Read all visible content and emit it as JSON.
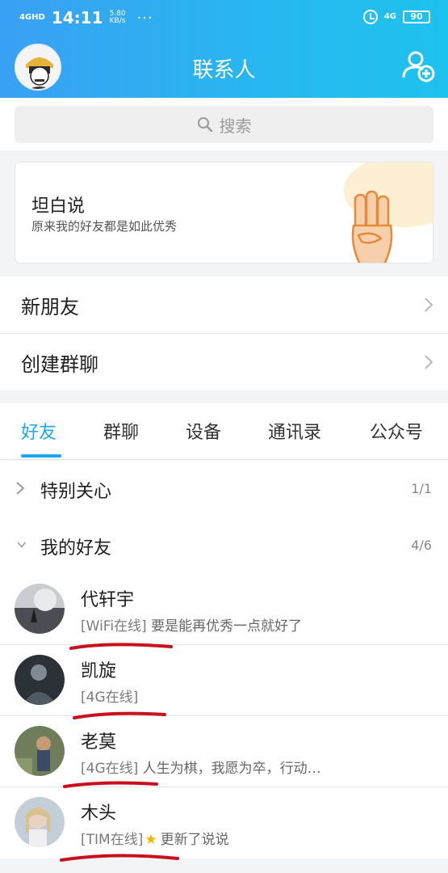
{
  "status_bar": {
    "network": "4GHD",
    "time": "14:11",
    "speed_value": "5.80",
    "speed_unit": "KB/s",
    "more": "···",
    "right_network": "4G",
    "battery": "90"
  },
  "header": {
    "title": "联系人"
  },
  "search": {
    "placeholder": "搜索"
  },
  "tanbai": {
    "title": "坦白说",
    "subtitle": "原来我的好友都是如此优秀"
  },
  "menu": [
    {
      "label": "新朋友"
    },
    {
      "label": "创建群聊"
    }
  ],
  "tabs": [
    {
      "label": "好友",
      "active": true
    },
    {
      "label": "群聊",
      "active": false
    },
    {
      "label": "设备",
      "active": false
    },
    {
      "label": "通讯录",
      "active": false
    },
    {
      "label": "公众号",
      "active": false
    }
  ],
  "groups": [
    {
      "name": "特别关心",
      "count": "1/1",
      "expanded": false
    },
    {
      "name": "我的好友",
      "count": "4/6",
      "expanded": true
    }
  ],
  "friends": [
    {
      "name": "代轩宇",
      "state": "[WiFi在线]",
      "message": "要是能再优秀一点就好了",
      "star": false
    },
    {
      "name": "凯旋",
      "state": "[4G在线]",
      "message": "",
      "star": false
    },
    {
      "name": "老莫",
      "state": "[4G在线]",
      "message": "人生为棋，我愿为卒，行动…",
      "star": false
    },
    {
      "name": "木头",
      "state": "[TIM在线]",
      "message": "更新了说说",
      "star": true
    }
  ],
  "colors": {
    "header_start": "#3aa0f4",
    "header_end": "#1ec2ee",
    "accent": "#1ea8ee",
    "annotation_red": "#c8101e"
  }
}
